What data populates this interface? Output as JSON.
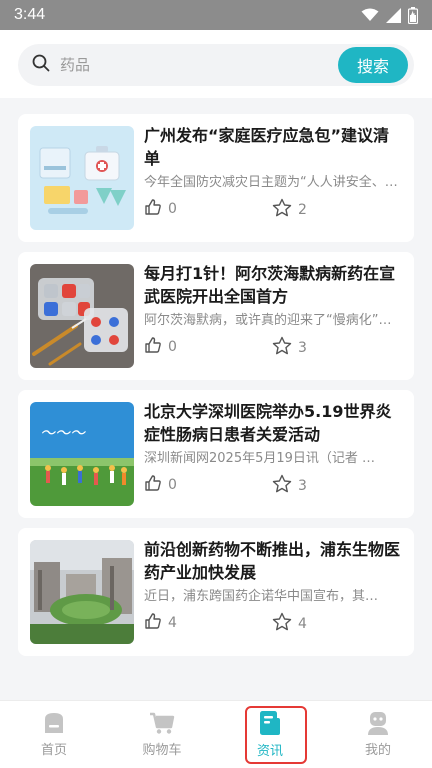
{
  "status_bar": {
    "time": "3:44",
    "icons": [
      "wifi-icon",
      "signal-icon",
      "battery-icon"
    ]
  },
  "search": {
    "placeholder": "药品",
    "button_label": "搜索",
    "icon": "search-icon"
  },
  "accent_color": "#1fb6c4",
  "highlight_color": "#e53935",
  "news": [
    {
      "title": "广州发布“家庭医疗应急包”建议清单",
      "summary": "今年全国防灾减灾日主题为“人人讲安全、个个会应急”…",
      "likes": "0",
      "stars": "2",
      "thumb_icon": "medical-kit-illustration"
    },
    {
      "title": "每月打1针！阿尔茨海默病新药在宣武医院开出全国首方",
      "summary": "阿尔茨海默病，或许真的迎来了“慢病化”…",
      "likes": "0",
      "stars": "3",
      "thumb_icon": "pills-and-syringe-photo"
    },
    {
      "title": "北京大学深圳医院举办5.19世界炎症性肠病日患者关爱活动",
      "summary": "深圳新闻网2025年5月19日讯（记者 …",
      "likes": "0",
      "stars": "3",
      "thumb_icon": "running-people-banner"
    },
    {
      "title": "前沿创新药物不断推出，浦东生物医药产业加快发展",
      "summary": "近日，浦东跨国药企诺华中国宣布，其…",
      "likes": "4",
      "stars": "4",
      "thumb_icon": "campus-aerial-photo"
    }
  ],
  "tabs": [
    {
      "label": "首页",
      "icon": "home-icon",
      "active": false
    },
    {
      "label": "购物车",
      "icon": "cart-icon",
      "active": false
    },
    {
      "label": "资讯",
      "icon": "news-icon",
      "active": true
    },
    {
      "label": "我的",
      "icon": "profile-icon",
      "active": false
    }
  ]
}
